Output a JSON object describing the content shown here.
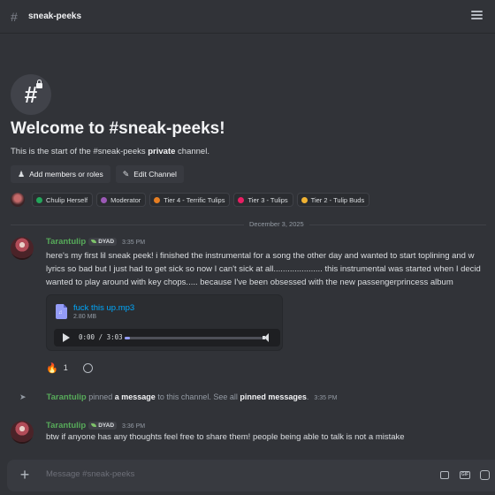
{
  "header": {
    "hash_glyph": "#",
    "channel_name": "sneak-peeks"
  },
  "welcome": {
    "icon_glyph": "#",
    "title": "Welcome to #sneak-peeks!",
    "subtitle_pre": "This is the start of the #sneak-peeks ",
    "subtitle_bold": "private",
    "subtitle_post": " channel.",
    "add_members_label": "Add members or roles",
    "add_members_icon": "person-plus-icon",
    "edit_channel_label": "Edit Channel",
    "edit_channel_icon": "pencil-icon"
  },
  "roles": [
    {
      "label": "Chulip Herself",
      "color": "#23a55a"
    },
    {
      "label": "Moderator",
      "color": "#9b59b6"
    },
    {
      "label": "Tier 4 - Terrific Tulips",
      "color": "#e67e22"
    },
    {
      "label": "Tier 3 - Tulips",
      "color": "#e91e63"
    },
    {
      "label": "Tier 2 - Tulip Buds",
      "color": "#f0b232"
    }
  ],
  "date_divider": "December 3, 2025",
  "messages": [
    {
      "author": "Tarantulip",
      "tag": "DYAD",
      "time": "3:35 PM",
      "lines": [
        "here's my first lil sneak peek! i finished the instrumental for a song the other day and wanted to start toplining and w",
        "lyrics so bad but I just had to get sick so now I can't sick at all..................... this instrumental was started when I decid",
        "wanted to play around with key chops..... because I've been obsessed with the new passengerprincess album"
      ],
      "attachment": {
        "file_name": "fuck this up.mp3",
        "file_size": "2.80 MB",
        "player_time": "0:00 / 3:03",
        "progress_fraction": 0.04
      },
      "reaction": {
        "emoji": "🔥",
        "count": "1"
      }
    },
    {
      "author": "Tarantulip",
      "tag": "DYAD",
      "time": "3:36 PM",
      "lines": [
        "btw if anyone has any thoughts feel free to share them! people being able to talk is not a mistake"
      ]
    }
  ],
  "system_pin": {
    "author": "Tarantulip",
    "text_1": " pinned ",
    "link_1": "a message",
    "text_2": " to this channel. See all ",
    "link_2": "pinned messages",
    "text_3": ".",
    "time": "3:35 PM"
  },
  "composer": {
    "placeholder": "Message #sneak-peeks",
    "gif_label": "GIF"
  }
}
